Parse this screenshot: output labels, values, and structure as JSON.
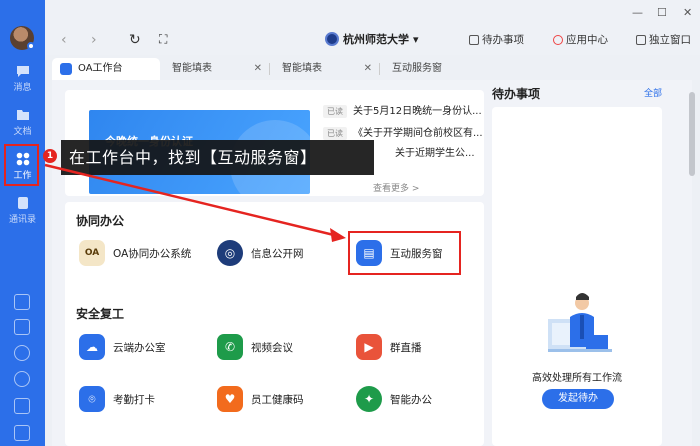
{
  "window": {
    "minimize": "—",
    "maximize": "☐",
    "close": "✕"
  },
  "nav": {
    "back": "‹",
    "forward": "›",
    "refresh": "↻",
    "screenshot": "⛶"
  },
  "campus": {
    "name": "杭州师范大学",
    "caret": "▾"
  },
  "toolbar": {
    "todo": "待办事项",
    "app_center": "应用中心",
    "standalone": "独立窗口"
  },
  "rail": {
    "items": [
      {
        "label": "消息",
        "icon": "message-icon"
      },
      {
        "label": "文档",
        "icon": "document-icon"
      },
      {
        "label": "工作",
        "icon": "grid-icon"
      },
      {
        "label": "通讯录",
        "icon": "contacts-icon"
      }
    ],
    "badge": "1"
  },
  "tabs": [
    {
      "label": "OA工作台",
      "active": true
    },
    {
      "label": "智能填表"
    },
    {
      "label": "智能填表"
    },
    {
      "label": "互动服务窗"
    }
  ],
  "tab_close": "✕",
  "banner": {
    "text": "今晚统一身份认证"
  },
  "news": [
    {
      "tag": "已读",
      "title": "关于5月12日晚统一身份认..."
    },
    {
      "tag": "已读",
      "title": "《关于开学期间仓前校区有..."
    },
    {
      "tag": "",
      "title": "关于近期学生公..."
    }
  ],
  "more": "查看更多 >",
  "sections": {
    "office": {
      "title": "协同办公",
      "apps": [
        "OA协同办公系统",
        "信息公开网",
        "互动服务窗"
      ]
    },
    "safe": {
      "title": "安全复工",
      "apps": [
        "云端办公室",
        "视频会议",
        "群直播",
        "考勤打卡",
        "员工健康码",
        "智能办公"
      ]
    }
  },
  "todo": {
    "title": "待办事项",
    "all": "全部",
    "empty_text": "高效处理所有工作流",
    "button": "发起待办"
  },
  "tooltip": "在工作台中，找到【互动服务窗】",
  "colors": {
    "brand": "#2c6fe9",
    "highlight": "#e52420"
  }
}
